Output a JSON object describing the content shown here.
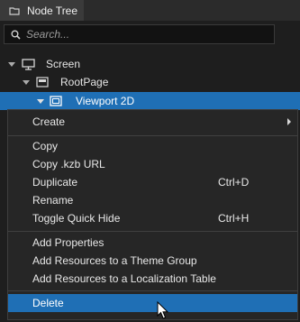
{
  "tab": {
    "title": "Node Tree"
  },
  "search": {
    "placeholder": "Search..."
  },
  "tree": {
    "items": [
      {
        "label": "Screen"
      },
      {
        "label": "RootPage"
      },
      {
        "label": "Viewport 2D"
      }
    ]
  },
  "menu": {
    "items": [
      {
        "label": "Create",
        "shortcut": ""
      },
      {
        "label": "Copy",
        "shortcut": ""
      },
      {
        "label": "Copy .kzb URL",
        "shortcut": ""
      },
      {
        "label": "Duplicate",
        "shortcut": "Ctrl+D"
      },
      {
        "label": "Rename",
        "shortcut": ""
      },
      {
        "label": "Toggle Quick Hide",
        "shortcut": "Ctrl+H"
      },
      {
        "label": "Add Properties",
        "shortcut": ""
      },
      {
        "label": "Add Resources to a Theme Group",
        "shortcut": ""
      },
      {
        "label": "Add Resources to a Localization Table",
        "shortcut": ""
      },
      {
        "label": "Delete",
        "shortcut": ""
      }
    ]
  },
  "colors": {
    "selection": "#1f6fb5",
    "menu_bg": "#262626"
  }
}
